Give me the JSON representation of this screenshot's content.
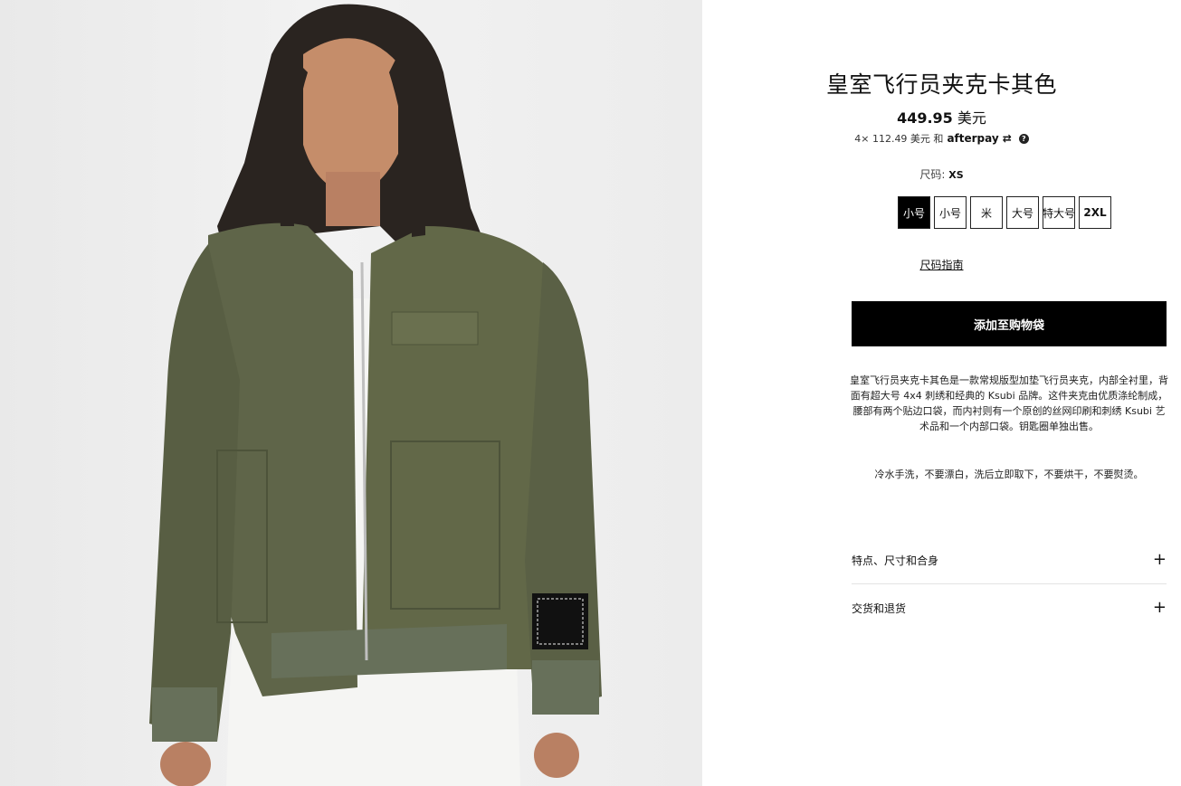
{
  "product": {
    "title": "皇室飞行员夹克卡其色",
    "price_amount": "449.95",
    "price_currency": "美元",
    "installments_text": "4× 112.49 美元 和",
    "afterpay_label": "afterpay",
    "size_label": "尺码:",
    "size_selected": "XS",
    "sizes": [
      "小号",
      "小号",
      "米",
      "大号",
      "特大号",
      "2XL"
    ],
    "size_guide": "尺码指南",
    "add_to_bag": "添加至购物袋",
    "description": "皇室飞行员夹克卡其色是一款常规版型加垫飞行员夹克，内部全衬里，背面有超大号 4x4 刺绣和经典的 Ksubi 品牌。这件夹克由优质涤纶制成，腰部有两个贴边口袋，而内衬则有一个原创的丝网印刷和刺绣 Ksubi 艺术品和一个内部口袋。钥匙圈单独出售。",
    "care": "冷水手洗，不要漂白，洗后立即取下，不要烘干，不要熨烫。",
    "accordion": [
      {
        "label": "特点、尺寸和合身"
      },
      {
        "label": "交货和退货"
      }
    ]
  },
  "colors": {
    "jacket": "#5f6549",
    "accent": "#000000"
  },
  "icons": [
    "help-icon",
    "plus-icon"
  ]
}
